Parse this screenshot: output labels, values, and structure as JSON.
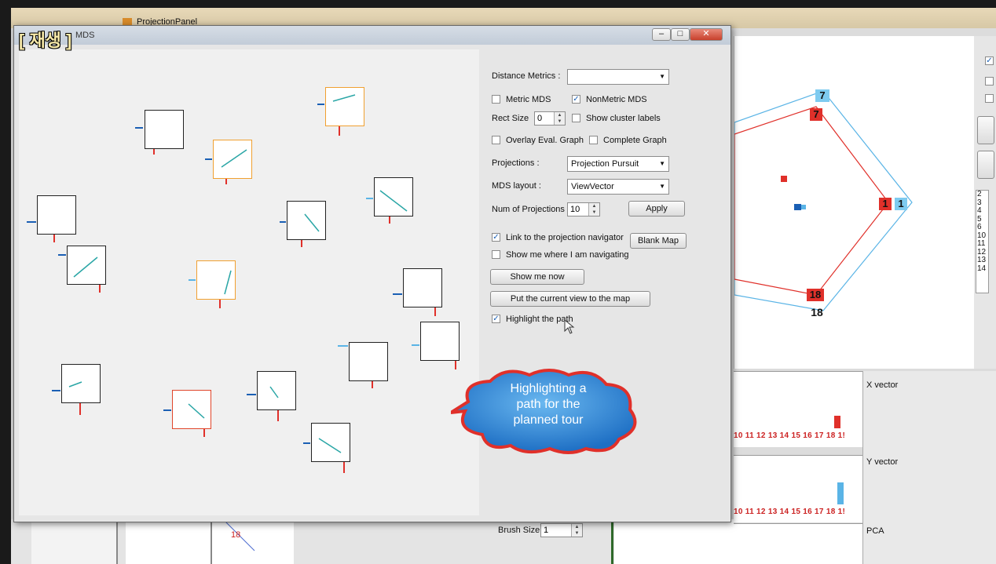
{
  "overlay_tag": "[ 재생 ]",
  "bg_window": {
    "title": "ProjectionPanel"
  },
  "window": {
    "title": "MDS",
    "controls": {
      "minimize": "–",
      "maximize": "□",
      "close": "✕"
    }
  },
  "panel": {
    "distance_metrics_label": "Distance Metrics :",
    "distance_metrics_value": "",
    "metric_mds": "Metric MDS",
    "nonmetric_mds": "NonMetric MDS",
    "rect_size_label": "Rect Size",
    "rect_size_value": "0",
    "show_cluster_labels": "Show cluster labels",
    "overlay_eval_graph": "Overlay Eval. Graph",
    "complete_graph": "Complete Graph",
    "projections_label": "Projections :",
    "projections_value": "Projection Pursuit",
    "mds_layout_label": "MDS layout :",
    "mds_layout_value": "ViewVector",
    "num_projections_label": "Num of Projections :",
    "num_projections_value": "10",
    "apply": "Apply",
    "link_navigator": "Link to the projection navigator",
    "blank_map": "Blank Map",
    "show_where": "Show me where I am navigating",
    "show_now": "Show me now",
    "put_view": "Put the current view to the map",
    "highlight_path": "Highlight the path"
  },
  "callout": "Highlighting a path for the planned tour",
  "radar": {
    "labels": [
      "7",
      "7",
      "1",
      "1",
      "18",
      "18"
    ]
  },
  "right_list": [
    "2",
    "3",
    "4",
    "5",
    "6",
    "10",
    "11",
    "12",
    "13",
    "14"
  ],
  "bottom_panels": {
    "x_vector": "X vector",
    "y_vector": "Y vector",
    "pca": "PCA",
    "axis_numbers": "10 11 12 13 14 15 16 17 18 1!",
    "brush_size_label": "Brush Size",
    "brush_size_value": "1",
    "bottom_left_label": "18"
  },
  "colors": {
    "red": "#e0302a",
    "blue": "#5ab4e6",
    "orange": "#f0a030"
  }
}
